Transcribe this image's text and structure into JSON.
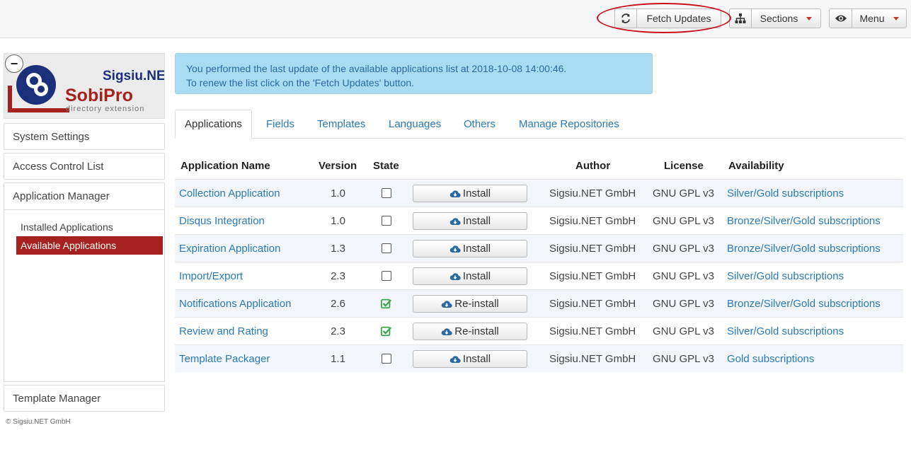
{
  "toolbar": {
    "fetch_label": "Fetch Updates",
    "sections_label": "Sections",
    "menu_label": "Menu"
  },
  "logo": {
    "brand": "Sigsiu.NET",
    "product": "SobiPro",
    "tagline": "directory extension"
  },
  "sidebar": {
    "items": [
      {
        "label": "System Settings"
      },
      {
        "label": "Access Control List"
      },
      {
        "label": "Application Manager"
      },
      {
        "label": "Template Manager"
      }
    ],
    "sub_items": [
      {
        "label": "Installed Applications",
        "active": false
      },
      {
        "label": "Available Applications",
        "active": true
      }
    ],
    "footer": "© Sigsiu.NET GmbH"
  },
  "alert": {
    "line1": "You performed the last update of the available applications list at 2018-10-08 14:00:46.",
    "line2": "To renew the list click on the 'Fetch Updates' button."
  },
  "tabs": [
    {
      "label": "Applications",
      "active": true
    },
    {
      "label": "Fields"
    },
    {
      "label": "Templates"
    },
    {
      "label": "Languages"
    },
    {
      "label": "Others"
    },
    {
      "label": "Manage Repositories"
    }
  ],
  "table": {
    "headers": [
      "Application Name",
      "Version",
      "State",
      "",
      "Author",
      "License",
      "Availability"
    ],
    "rows": [
      {
        "name": "Collection Application",
        "version": "1.0",
        "installed": false,
        "action": "Install",
        "author": "Sigsiu.NET GmbH",
        "license": "GNU GPL v3",
        "availability": "Silver/Gold subscriptions"
      },
      {
        "name": "Disqus Integration",
        "version": "1.0",
        "installed": false,
        "action": "Install",
        "author": "Sigsiu.NET GmbH",
        "license": "GNU GPL v3",
        "availability": "Bronze/Silver/Gold subscriptions"
      },
      {
        "name": "Expiration Application",
        "version": "1.3",
        "installed": false,
        "action": "Install",
        "author": "Sigsiu.NET GmbH",
        "license": "GNU GPL v3",
        "availability": "Bronze/Silver/Gold subscriptions"
      },
      {
        "name": "Import/Export",
        "version": "2.3",
        "installed": false,
        "action": "Install",
        "author": "Sigsiu.NET GmbH",
        "license": "GNU GPL v3",
        "availability": "Silver/Gold subscriptions"
      },
      {
        "name": "Notifications Application",
        "version": "2.6",
        "installed": true,
        "action": "Re-install",
        "author": "Sigsiu.NET GmbH",
        "license": "GNU GPL v3",
        "availability": "Bronze/Silver/Gold subscriptions"
      },
      {
        "name": "Review and Rating",
        "version": "2.3",
        "installed": true,
        "action": "Re-install",
        "author": "Sigsiu.NET GmbH",
        "license": "GNU GPL v3",
        "availability": "Silver/Gold subscriptions"
      },
      {
        "name": "Template Packager",
        "version": "1.1",
        "installed": false,
        "action": "Install",
        "author": "Sigsiu.NET GmbH",
        "license": "GNU GPL v3",
        "availability": "Gold subscriptions"
      }
    ]
  },
  "colors": {
    "link": "#2a7ab8",
    "active_nav": "#a5211d",
    "alert_bg": "#a9dcf2",
    "check_green": "#3aa54a",
    "highlight_ellipse": "#c8101b"
  },
  "icons": [
    "refresh-icon",
    "sitemap-icon",
    "caret-down-icon",
    "eye-icon",
    "collapse-icon",
    "cloud-download-icon",
    "checkbox-icon",
    "check-square-icon"
  ]
}
